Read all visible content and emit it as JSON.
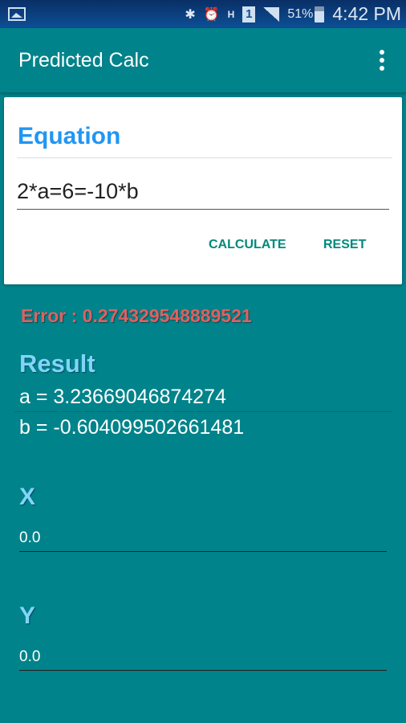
{
  "status_bar": {
    "battery": "51%",
    "time": "4:42 PM",
    "sim": "1",
    "network": "H"
  },
  "app_bar": {
    "title": "Predicted Calc",
    "menu_icon": "more-vert-icon"
  },
  "equation": {
    "label": "Equation",
    "value": "2*a=6=-10*b",
    "calculate_label": "CALCULATE",
    "reset_label": "RESET"
  },
  "error": {
    "text": "Error : 0.274329548889521"
  },
  "result": {
    "label": "Result",
    "lines": [
      "a = 3.23669046874274",
      "b = -0.604099502661481"
    ]
  },
  "x_field": {
    "label": "X",
    "value": "0.0"
  },
  "y_field": {
    "label": "Y",
    "value": "0.0"
  },
  "colors": {
    "primary": "#00838a",
    "accent": "#2196f3",
    "error": "#e06060",
    "result_label": "#81d4fa"
  }
}
